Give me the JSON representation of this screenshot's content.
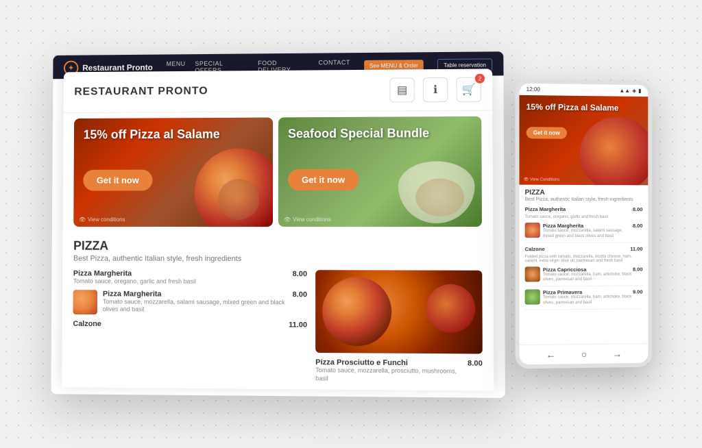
{
  "background": {
    "dot_color": "#cccccc"
  },
  "navbar": {
    "logo_text": "Restaurant Pronto",
    "links": [
      "MENU",
      "SPECIAL OFFERS",
      "FOOD DELIVERY",
      "CONTACT"
    ],
    "btn_orange": "See MENU & Order",
    "btn_outline": "Table reservation"
  },
  "app": {
    "title": "RESTAURANT PRONTO",
    "icons": {
      "menu_icon": "☰",
      "info_icon": "ⓘ",
      "cart_icon": "🛒",
      "cart_count": "2"
    },
    "promos": [
      {
        "title": "15% off Pizza al Salame",
        "cta": "Get it now",
        "view_conditions": "View conditions"
      },
      {
        "title": "Seafood Special Bundle",
        "cta": "Get it now",
        "view_conditions": "View conditions"
      }
    ],
    "category": {
      "name": "PIZZA",
      "description": "Best Pizza, authentic Italian style, fresh ingredients"
    },
    "menu_items": [
      {
        "name": "Pizza Margherita",
        "description": "Tomato sauce, oregano, garlic and fresh basil",
        "price": "8.00",
        "has_thumb": false
      },
      {
        "name": "Pizza Margherita",
        "description": "Tomato sauce, mozzarella, salami sausage, mixed green and black olives and basil",
        "price": "8.00",
        "has_thumb": true
      },
      {
        "name": "Calzone",
        "description": "",
        "price": "11.00",
        "has_thumb": false
      }
    ],
    "featured_item": {
      "name": "Pizza Prosciutto e Funchi",
      "description": "Tomato sauce, mozzarella, prosciutto, mushrooms, basil",
      "price": "8.00"
    }
  },
  "mobile": {
    "status_bar": {
      "time": "12:00",
      "signal": "▲▲▲",
      "wifi": "WiFi",
      "battery": "■"
    },
    "promo": {
      "title": "15% off Pizza al Salame",
      "cta": "Get it now",
      "view_conditions": "View Conditions"
    },
    "category": {
      "name": "PIZZA",
      "description": "Best Pizza, authentic Italian style, fresh ingredients"
    },
    "menu_items": [
      {
        "name": "Pizza Margherita",
        "description": "Tomato sauce, oregano, garlic and fresh basil",
        "price": "8.00",
        "has_thumb": false
      },
      {
        "name": "Pizza Margherita",
        "description": "Tomato sauce, mozzarella, salami sausage, mixed green and black olives and basil",
        "price": "8.00",
        "has_thumb": true
      },
      {
        "name": "Calzone",
        "description": "Folded pizza with tomato, mozzarella, ricotta cheese, ham, salami, extra virgin olive oil, parmesan and fresh basil",
        "price": "11.00",
        "has_thumb": false
      },
      {
        "name": "Pizza Capricciosa",
        "description": "Tomato sauce, mozzarella, ham, artichoke, black olives, parmesan and basil",
        "price": "8.00",
        "has_thumb": true
      },
      {
        "name": "Pizza Primavera",
        "description": "Tomato sauce, mozzarella, ham, artichoke, black olives, parmesan and basil",
        "price": "9.00",
        "has_thumb": true
      }
    ],
    "nav": {
      "back": "←",
      "home": "○",
      "forward": "→"
    }
  }
}
